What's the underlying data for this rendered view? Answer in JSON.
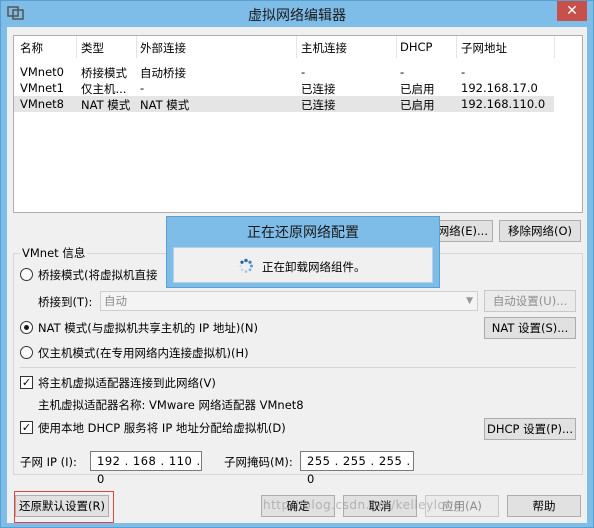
{
  "window": {
    "title": "虚拟网络编辑器"
  },
  "table": {
    "columns": [
      "名称",
      "类型",
      "外部连接",
      "主机连接",
      "DHCP",
      "子网地址"
    ],
    "rows": [
      [
        "VMnet0",
        "桥接模式",
        "自动桥接",
        "-",
        "-",
        "-"
      ],
      [
        "VMnet1",
        "仅主机...",
        "-",
        "已连接",
        "已启用",
        "192.168.17.0"
      ],
      [
        "VMnet8",
        "NAT 模式",
        "NAT 模式",
        "已连接",
        "已启用",
        "192.168.110.0"
      ]
    ],
    "selected_row": 2
  },
  "buttons": {
    "add_network": "网络(E)...",
    "remove_network": "移除网络(O)",
    "auto_settings": "自动设置(U)...",
    "nat_settings": "NAT 设置(S)...",
    "dhcp_settings": "DHCP 设置(P)...",
    "restore_defaults": "还原默认设置(R)",
    "ok": "确定",
    "cancel": "取消",
    "apply": "应用(A)",
    "help": "帮助"
  },
  "vmnet_info": {
    "group_label": "VMnet 信息",
    "bridged_radio": "桥接模式(将虚拟机直接",
    "bridged_to_label": "桥接到(T):",
    "bridged_to_value": "自动",
    "nat_radio": "NAT 模式(与虚拟机共享主机的 IP 地址)(N)",
    "host_only_radio": "仅主机模式(在专用网络内连接虚拟机)(H)",
    "selected_mode": "nat",
    "connect_adapter_checkbox": "将主机虚拟适配器连接到此网络(V)",
    "connect_adapter_checked": true,
    "adapter_name": "主机虚拟适配器名称: VMware 网络适配器 VMnet8",
    "dhcp_checkbox": "使用本地 DHCP 服务将 IP 地址分配给虚拟机(D)",
    "dhcp_checked": true,
    "subnet_ip_label": "子网 IP (I):",
    "subnet_ip": "192 . 168 . 110 .  0",
    "subnet_mask_label": "子网掩码(M):",
    "subnet_mask": "255 . 255 . 255 .  0"
  },
  "progress_popup": {
    "title": "正在还原网络配置",
    "message": "正在卸载网络组件。"
  },
  "watermark": "http://blog.csdn.net/kelleylong",
  "colors": {
    "titlebar": "#7fbde9",
    "close_button": "#c7504b",
    "highlight_box": "#e0443b"
  }
}
